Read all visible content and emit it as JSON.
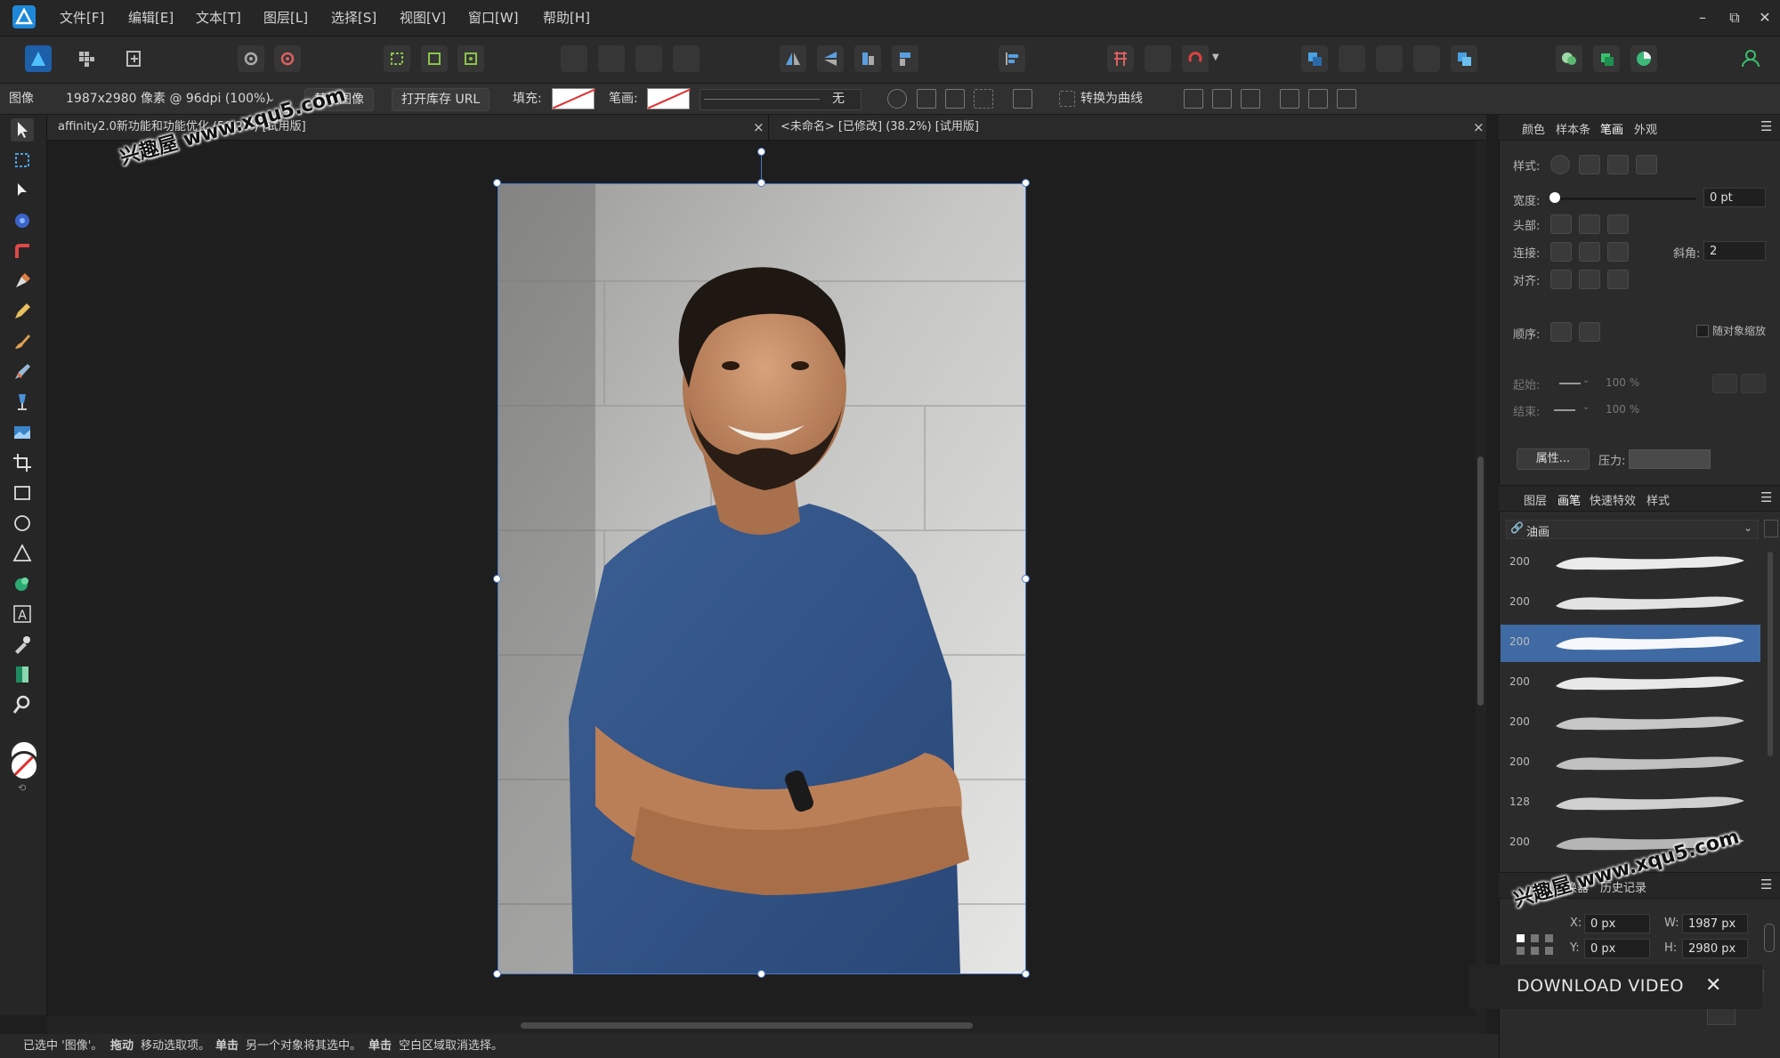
{
  "menu": {
    "items": [
      "文件[F]",
      "编辑[E]",
      "文本[T]",
      "图层[L]",
      "选择[S]",
      "视图[V]",
      "窗口[W]",
      "帮助[H]"
    ],
    "window_controls": [
      "–",
      "⧉",
      "✕"
    ]
  },
  "context_bar": {
    "label": "图像",
    "dimensions": "1987x2980 像素 @ 96dpi (100%)",
    "replace_image": "替换图像",
    "open_url": "打开库存 URL",
    "fill_label": "填充:",
    "stroke_label": "笔画:",
    "stroke_value": "无",
    "convert_curves": "转换为曲线"
  },
  "tabs": [
    {
      "title": "affinity2.0新功能和功能优化 (50.2%) [试用版]",
      "close": "×"
    },
    {
      "title": "<未命名> [已修改] (38.2%) [试用版]",
      "close": "×"
    }
  ],
  "status": {
    "selected": "已选中 '图像'。",
    "drag": "拖动",
    "drag_desc": "移动选取项。",
    "click": "单击",
    "click_desc": "另一个对象将其选中。",
    "click2": "单击",
    "click2_desc": "空白区域取消选择。"
  },
  "stroke_panel": {
    "tabs": [
      "颜色",
      "样本条",
      "笔画",
      "外观"
    ],
    "style_label": "样式:",
    "width_label": "宽度:",
    "width_value": "0 pt",
    "cap_label": "头部:",
    "join_label": "连接:",
    "miter_label": "斜角:",
    "miter_value": "2",
    "align_label": "对齐:",
    "order_label": "顺序:",
    "scale_label": "随对象缩放",
    "start_label": "起始:",
    "end_label": "结束:",
    "start_pct": "100 %",
    "end_pct": "100 %",
    "properties_btn": "属性...",
    "pressure_label": "压力:"
  },
  "brush_panel": {
    "tabs": [
      "图层",
      "画笔",
      "快速特效",
      "样式"
    ],
    "category": "油画",
    "brushes": [
      {
        "size": "200",
        "selected": false
      },
      {
        "size": "200",
        "selected": false
      },
      {
        "size": "200",
        "selected": true
      },
      {
        "size": "200",
        "selected": false
      },
      {
        "size": "200",
        "selected": false
      },
      {
        "size": "200",
        "selected": false
      },
      {
        "size": "128",
        "selected": false
      },
      {
        "size": "200",
        "selected": false
      }
    ]
  },
  "transform_panel": {
    "tabs": [
      "变换器",
      "历史记录"
    ],
    "x_label": "X:",
    "x_value": "0 px",
    "y_label": "Y:",
    "y_value": "0 px",
    "w_label": "W:",
    "w_value": "1987 px",
    "h_label": "H:",
    "h_value": "2980 px"
  },
  "overlay": {
    "download_video": "DOWNLOAD VIDEO",
    "close": "✕"
  },
  "watermarks": [
    "兴趣屋 www.xqu5.com",
    "兴趣屋 www.xqu5.com"
  ],
  "colors": {
    "accent": "#4d78b8",
    "selection_row": "#3f6aa3",
    "app_logo": "#2aa3e8"
  }
}
